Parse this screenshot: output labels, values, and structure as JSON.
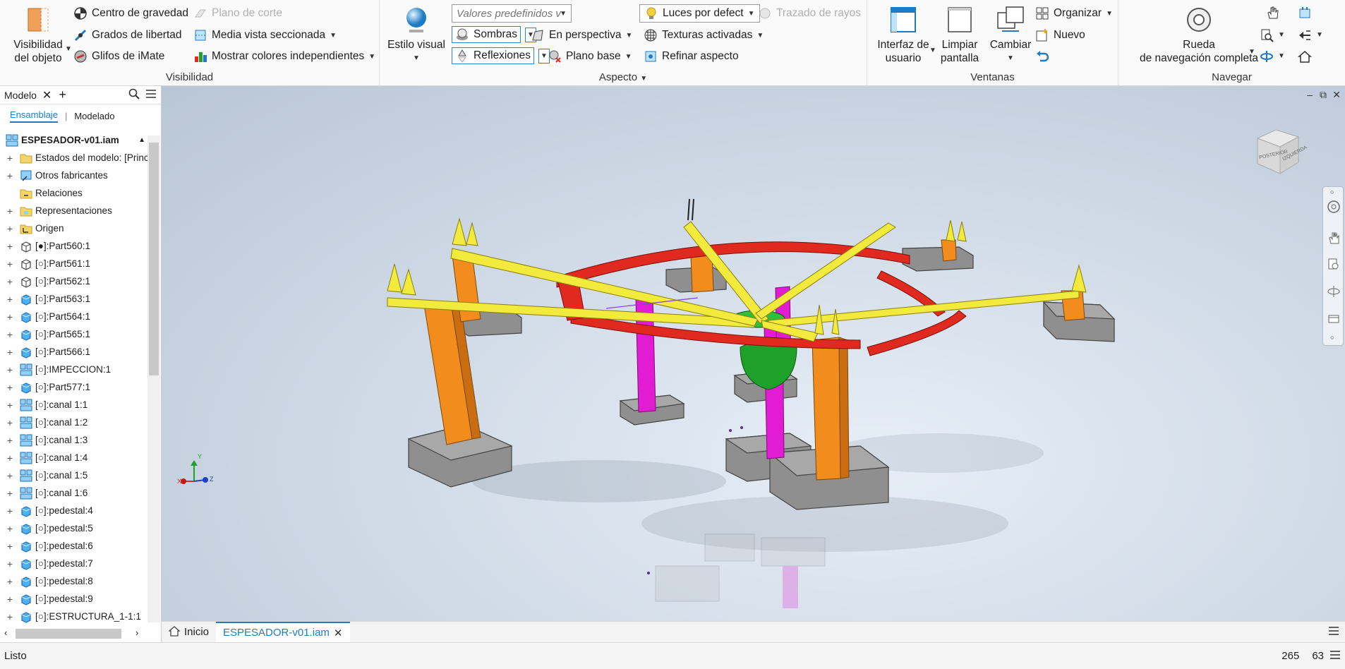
{
  "ribbon": {
    "visibility": {
      "title": "Visibilidad",
      "object_visibility": "Visibilidad\ndel objeto",
      "center_gravity": "Centro de gravedad",
      "dof": "Grados de libertad",
      "imate_glyphs": "Glifos de iMate",
      "cut_plane": "Plano de corte",
      "half_section": "Media vista seccionada",
      "show_colors": "Mostrar colores independientes"
    },
    "appearance": {
      "title": "Aspecto",
      "visual_style": "Estilo visual",
      "presets_placeholder": "Valores predefinidos v",
      "shadows": "Sombras",
      "reflections": "Reflexiones",
      "perspective": "En perspectiva",
      "ground_plane": "Plano base",
      "lights": "Luces por defect",
      "textures": "Texturas activadas",
      "refine": "Refinar aspecto",
      "ray_tracing": "Trazado de rayos"
    },
    "windows": {
      "title": "Ventanas",
      "ui": "Interfaz de\nusuario",
      "clean": "Limpiar\npantalla",
      "switch": "Cambiar",
      "arrange": "Organizar",
      "new": "Nuevo"
    },
    "navigate": {
      "title": "Navegar",
      "wheel": "Rueda\nde navegación completa"
    }
  },
  "browser": {
    "tab_label": "Modelo",
    "subtab_assembly": "Ensamblaje",
    "subtab_modeling": "Modelado",
    "root": "ESPESADOR-v01.iam",
    "items": [
      {
        "label": "Estados del modelo: [Princi",
        "icon": "folder-icon"
      },
      {
        "label": "Otros fabricantes",
        "icon": "third-party-icon"
      },
      {
        "label": "Relaciones",
        "icon": "relations-icon"
      },
      {
        "label": "Representaciones",
        "icon": "representations-icon"
      },
      {
        "label": "Origen",
        "icon": "origin-icon"
      },
      {
        "label": "[●]:Part560:1",
        "icon": "part-wire-icon"
      },
      {
        "label": "[○]:Part561:1",
        "icon": "part-wire-icon"
      },
      {
        "label": "[○]:Part562:1",
        "icon": "part-wire-icon"
      },
      {
        "label": "[○]:Part563:1",
        "icon": "part-icon"
      },
      {
        "label": "[○]:Part564:1",
        "icon": "part-icon"
      },
      {
        "label": "[○]:Part565:1",
        "icon": "part-icon"
      },
      {
        "label": "[○]:Part566:1",
        "icon": "part-icon"
      },
      {
        "label": "[○]:IMPECCION:1",
        "icon": "assembly-icon"
      },
      {
        "label": "[○]:Part577:1",
        "icon": "part-icon"
      },
      {
        "label": "[○]:canal 1:1",
        "icon": "assembly-icon"
      },
      {
        "label": "[○]:canal 1:2",
        "icon": "assembly-icon"
      },
      {
        "label": "[○]:canal 1:3",
        "icon": "assembly-icon"
      },
      {
        "label": "[○]:canal 1:4",
        "icon": "assembly-icon"
      },
      {
        "label": "[○]:canal 1:5",
        "icon": "assembly-icon"
      },
      {
        "label": "[○]:canal 1:6",
        "icon": "assembly-icon"
      },
      {
        "label": "[○]:pedestal:4",
        "icon": "part-icon"
      },
      {
        "label": "[○]:pedestal:5",
        "icon": "part-icon"
      },
      {
        "label": "[○]:pedestal:6",
        "icon": "part-icon"
      },
      {
        "label": "[○]:pedestal:7",
        "icon": "part-icon"
      },
      {
        "label": "[○]:pedestal:8",
        "icon": "part-icon"
      },
      {
        "label": "[○]:pedestal:9",
        "icon": "part-icon"
      },
      {
        "label": "[○]:ESTRUCTURA_1-1:1",
        "icon": "part-icon"
      }
    ]
  },
  "viewcube": {
    "face_left": "POSTERIOR",
    "face_right": "IZQUIERDA"
  },
  "axes": {
    "x": "X",
    "y": "Y",
    "z": "Z"
  },
  "doc_tabs": {
    "home": "Inicio",
    "active": "ESPESADOR-v01.iam"
  },
  "status": {
    "text": "Listo",
    "num1": "265",
    "num2": "63"
  },
  "colors": {
    "accent": "#1f7cc4",
    "yellow": "#f2ea3c",
    "red": "#e02a1f",
    "orange": "#f28c1c",
    "magenta": "#e21cd2",
    "gray": "#9a9a9a",
    "green": "#1ea02a"
  }
}
